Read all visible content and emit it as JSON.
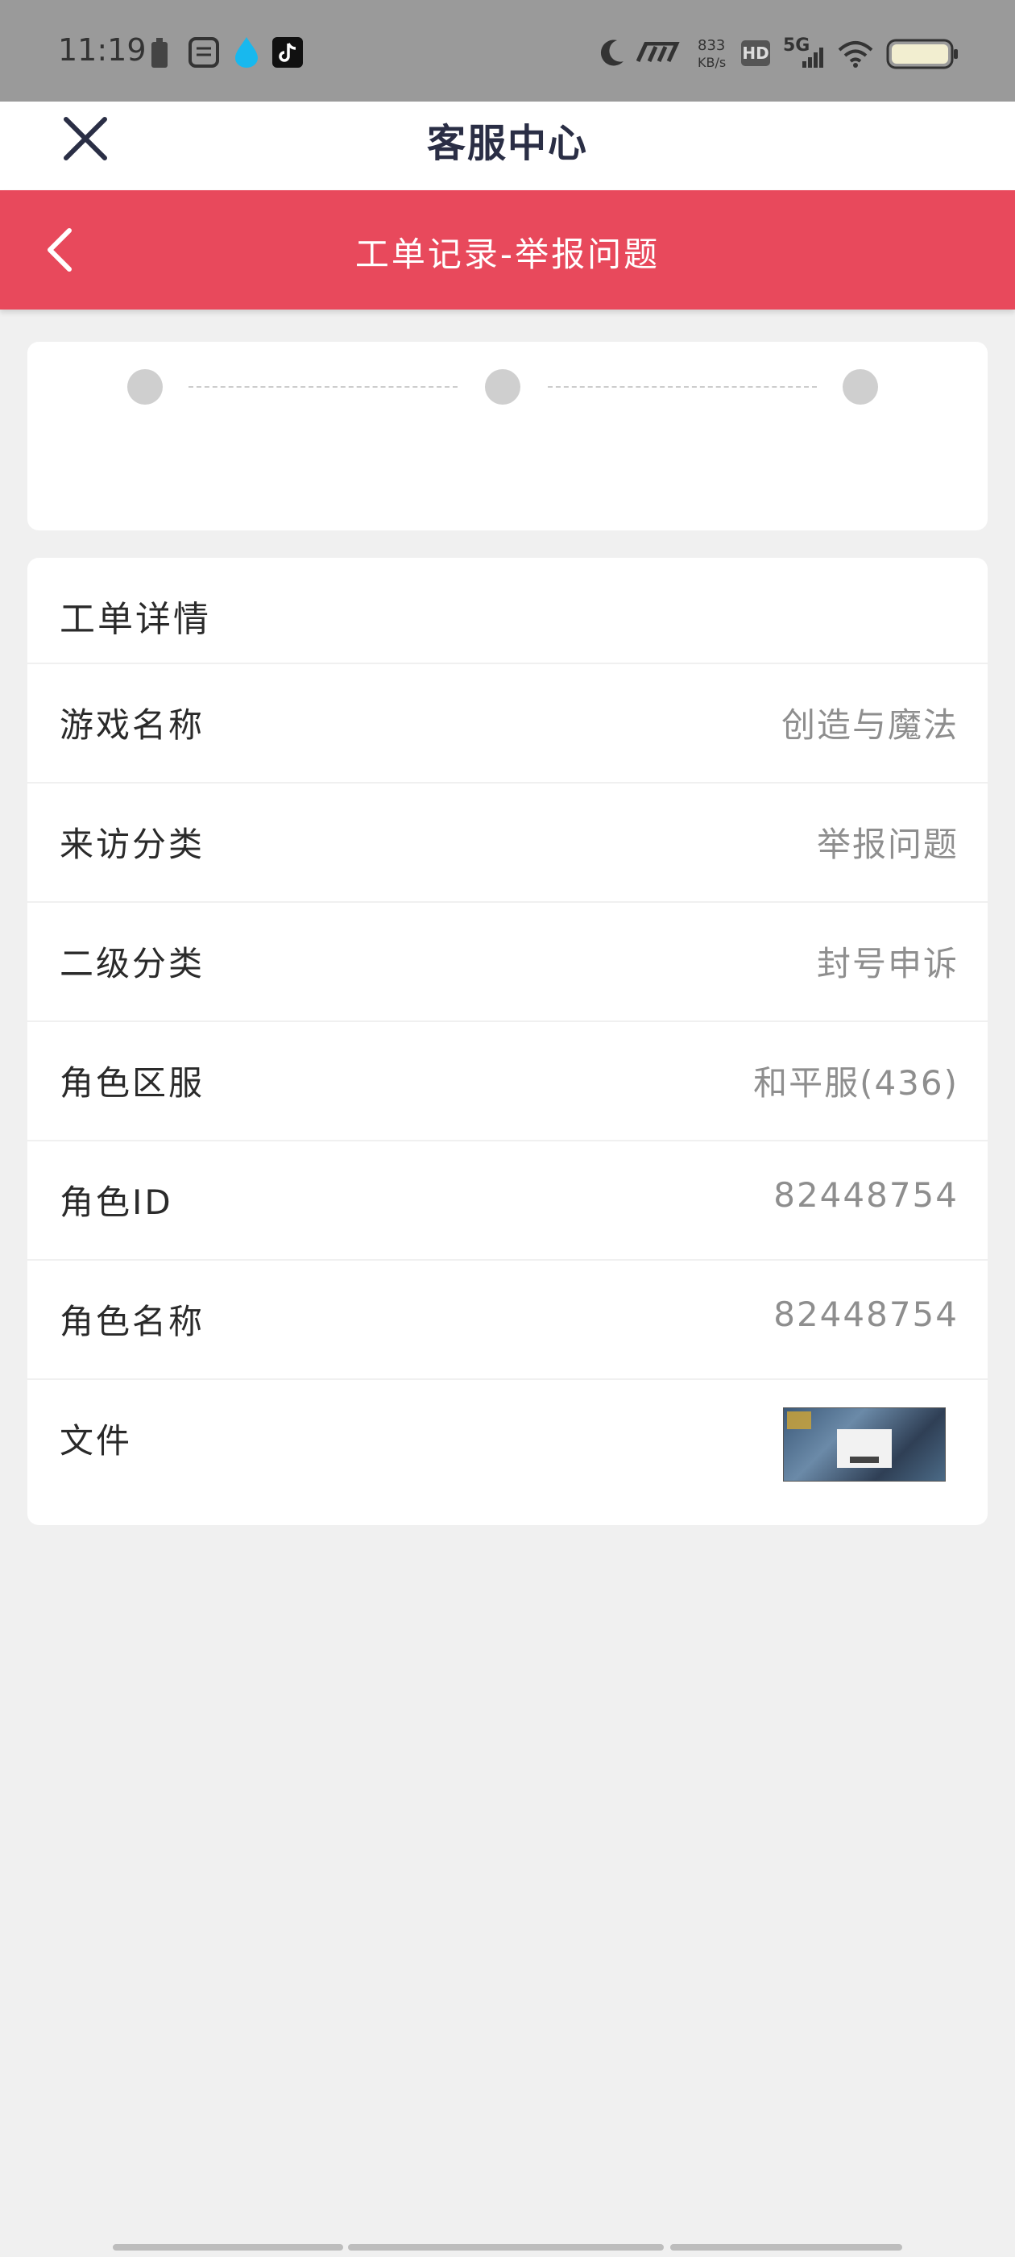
{
  "status_bar": {
    "time": "11:19",
    "net_speed_value": "833",
    "net_speed_unit": "KB/s",
    "hd_badge": "HD",
    "network": "5G",
    "icons": [
      "battery-small-icon",
      "app-icon",
      "drop-icon",
      "tiktok-icon",
      "moon-icon",
      "mm-icon",
      "signal-icon",
      "wifi-icon",
      "battery-icon"
    ]
  },
  "header": {
    "title": "客服中心",
    "close_icon": "close-icon"
  },
  "sub_header": {
    "title": "工单记录-举报问题",
    "back_icon": "chevron-left-icon",
    "color": "#e8495c"
  },
  "progress": {
    "steps": 3
  },
  "details": {
    "title": "工单详情",
    "rows": [
      {
        "label": "游戏名称",
        "value": "创造与魔法"
      },
      {
        "label": "来访分类",
        "value": "举报问题"
      },
      {
        "label": "二级分类",
        "value": "封号申诉"
      },
      {
        "label": "角色区服",
        "value": "和平服(436)"
      },
      {
        "label": "角色ID",
        "value": "82448754"
      },
      {
        "label": "角色名称",
        "value": "82448754"
      }
    ],
    "file_label": "文件"
  }
}
